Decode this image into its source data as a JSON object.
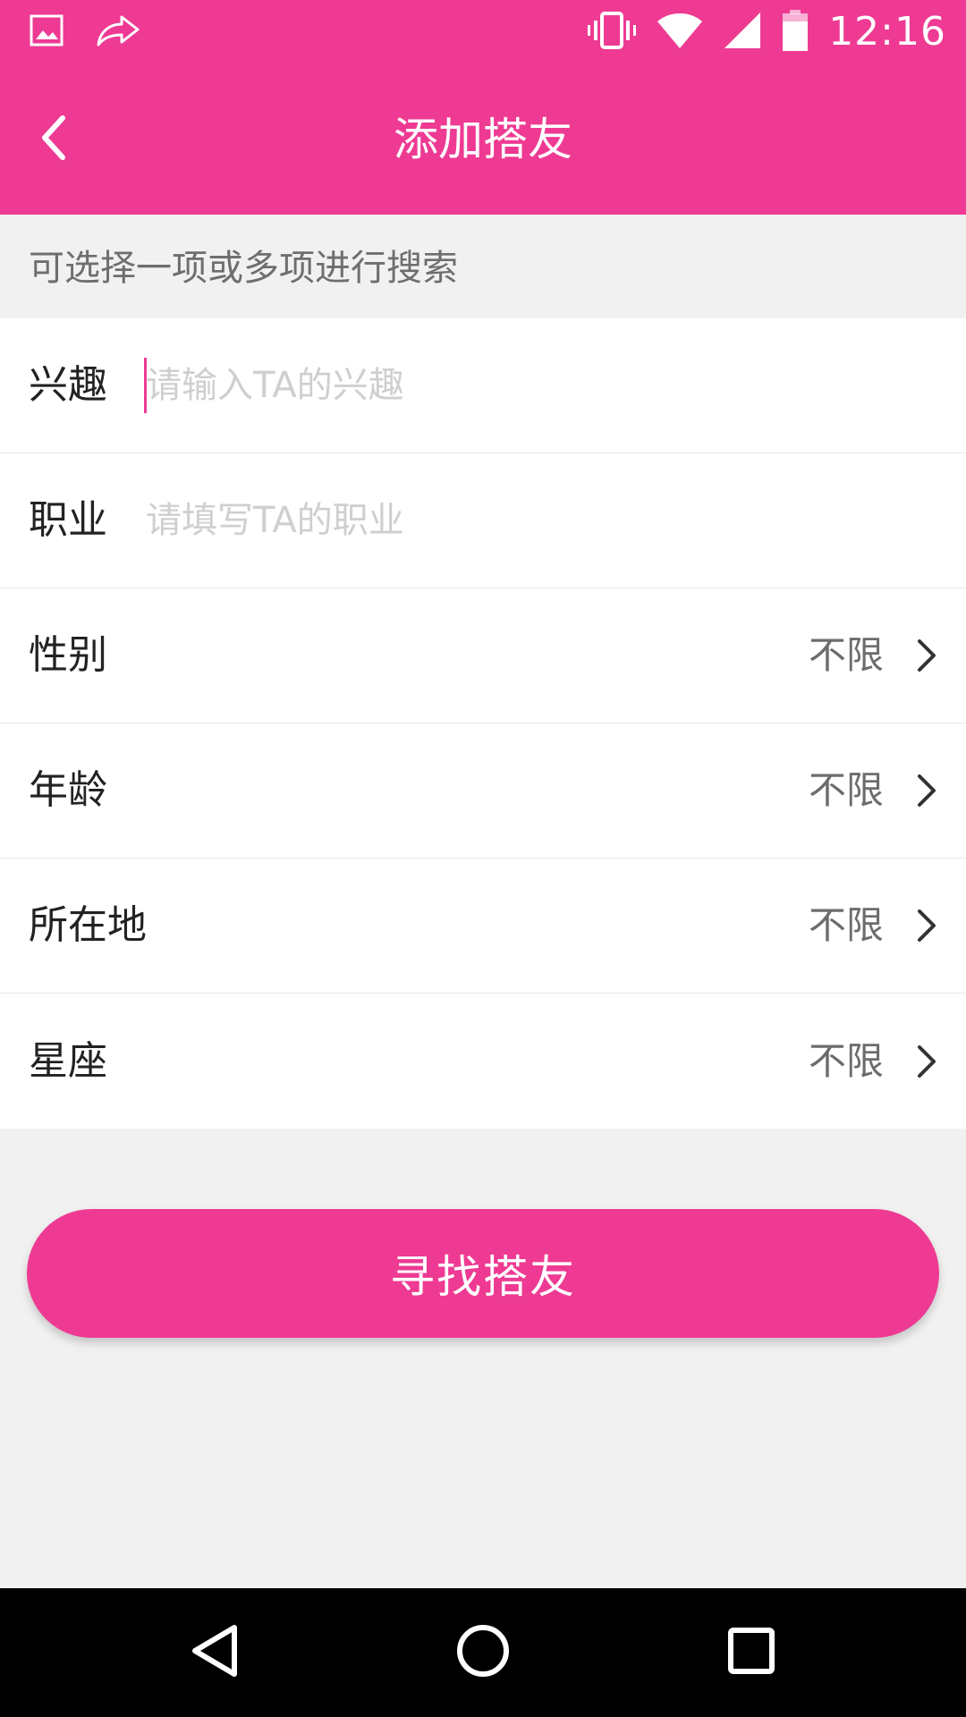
{
  "status_bar": {
    "time": "12:16",
    "icons": [
      "image-icon",
      "share-icon",
      "vibrate-icon",
      "wifi-icon",
      "signal-icon",
      "battery-icon"
    ]
  },
  "app_bar": {
    "title": "添加搭友",
    "back_icon": "chevron-left-icon"
  },
  "hint": "可选择一项或多项进行搜索",
  "form": {
    "interest": {
      "label": "兴趣",
      "value": "",
      "placeholder": "请输入TA的兴趣"
    },
    "job": {
      "label": "职业",
      "value": "",
      "placeholder": "请填写TA的职业"
    },
    "gender": {
      "label": "性别",
      "value": "不限"
    },
    "age": {
      "label": "年龄",
      "value": "不限"
    },
    "location": {
      "label": "所在地",
      "value": "不限"
    },
    "constellation": {
      "label": "星座",
      "value": "不限"
    }
  },
  "button": {
    "label": "寻找搭友"
  },
  "nav_bar": {
    "icons": [
      "back-triangle-icon",
      "home-circle-icon",
      "recents-square-icon"
    ]
  },
  "colors": {
    "accent": "#ee3a93",
    "background": "#f1f1f1",
    "card": "#ffffff",
    "placeholder": "#cfcfcf",
    "value_text": "#6c6c6c"
  }
}
